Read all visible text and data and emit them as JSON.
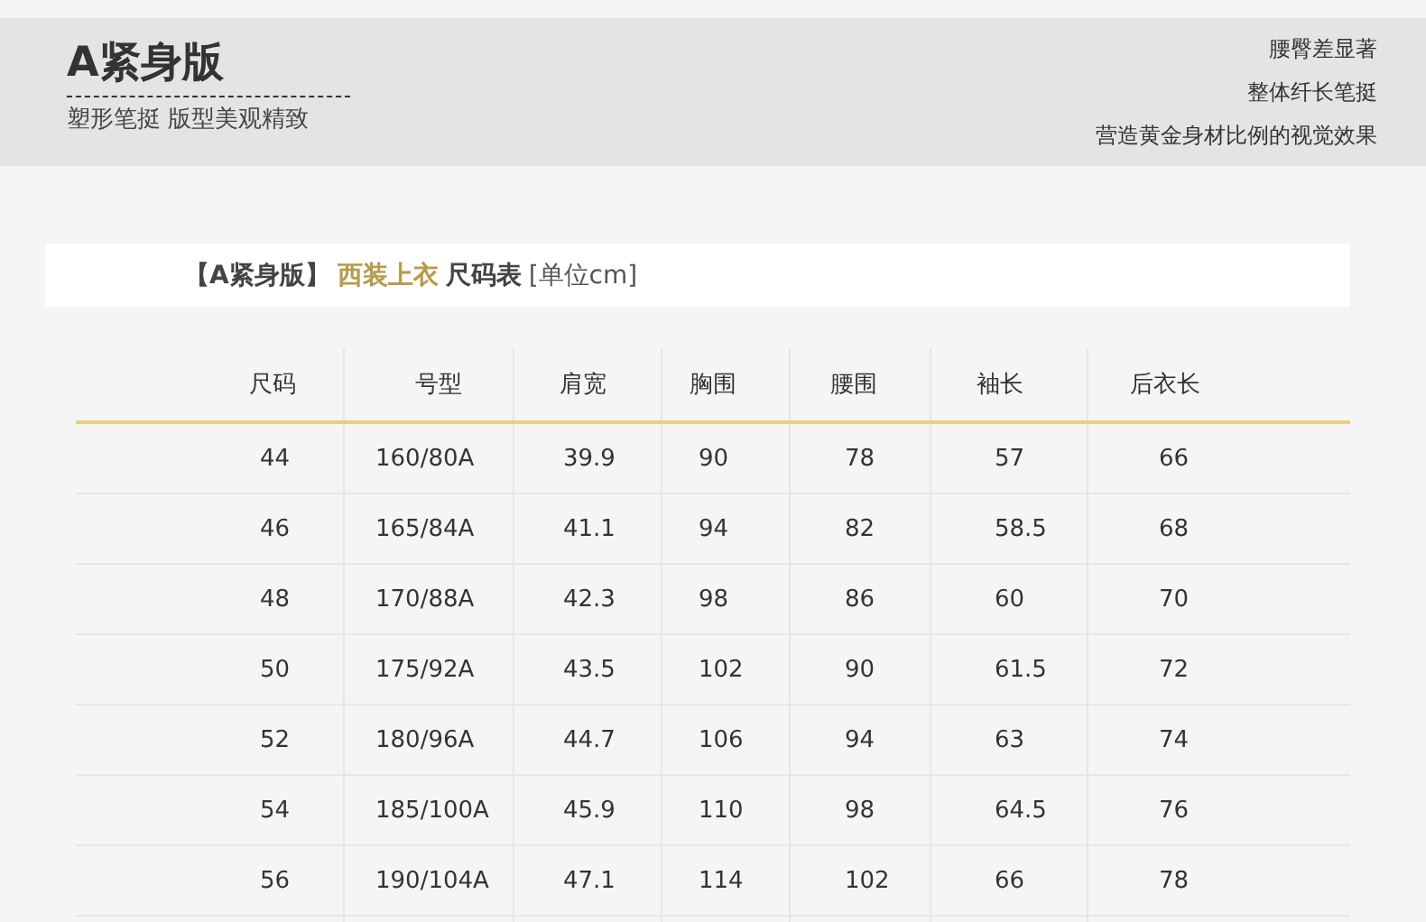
{
  "banner": {
    "title": "A紧身版",
    "subtitle": "塑形笔挺 版型美观精致",
    "notes": [
      "腰臀差显著",
      "整体纤长笔挺",
      "营造黄金身材比例的视觉效果"
    ]
  },
  "heading": {
    "edition": "【A紧身版】",
    "product": "西装上衣",
    "name": "尺码表",
    "unit": "[单位cm]"
  },
  "table": {
    "columns": [
      "尺码",
      "号型",
      "肩宽",
      "胸围",
      "腰围",
      "袖长",
      "后衣长"
    ],
    "rows": [
      [
        "44",
        "160/80A",
        "39.9",
        "90",
        "78",
        "57",
        "66"
      ],
      [
        "46",
        "165/84A",
        "41.1",
        "94",
        "82",
        "58.5",
        "68"
      ],
      [
        "48",
        "170/88A",
        "42.3",
        "98",
        "86",
        "60",
        "70"
      ],
      [
        "50",
        "175/92A",
        "43.5",
        "102",
        "90",
        "61.5",
        "72"
      ],
      [
        "52",
        "180/96A",
        "44.7",
        "106",
        "94",
        "63",
        "74"
      ],
      [
        "54",
        "185/100A",
        "45.9",
        "110",
        "98",
        "64.5",
        "76"
      ],
      [
        "56",
        "190/104A",
        "47.1",
        "114",
        "102",
        "66",
        "78"
      ]
    ]
  }
}
